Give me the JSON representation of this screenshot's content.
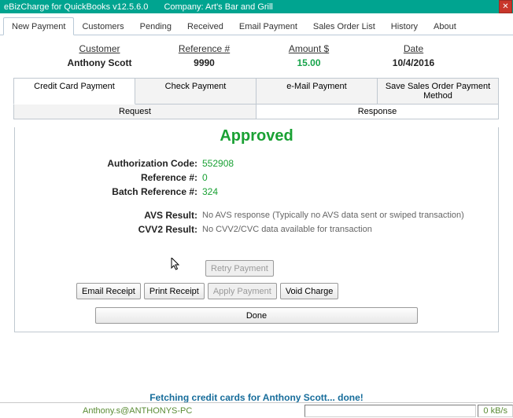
{
  "title_app": "eBizCharge for QuickBooks v12.5.6.0",
  "title_company": "Company: Art's Bar and Grill",
  "close_glyph": "✕",
  "tabs": [
    "New Payment",
    "Customers",
    "Pending",
    "Received",
    "Email Payment",
    "Sales Order List",
    "History",
    "About"
  ],
  "summary": {
    "h_customer": "Customer",
    "customer": "Anthony Scott",
    "h_ref": "Reference #",
    "ref": "9990",
    "h_amount": "Amount $",
    "amount": "15.00",
    "h_date": "Date",
    "date": "10/4/2016"
  },
  "pay_tabs": [
    "Credit Card Payment",
    "Check Payment",
    "e-Mail Payment",
    "Save Sales Order Payment Method"
  ],
  "rr_tabs": [
    "Request",
    "Response"
  ],
  "approved": "Approved",
  "kv": {
    "auth_k": "Authorization Code:",
    "auth_v": "552908",
    "ref_k": "Reference #:",
    "ref_v": "0",
    "batch_k": "Batch Reference #:",
    "batch_v": "324",
    "avs_k": "AVS Result:",
    "avs_v": "No AVS response (Typically no AVS data sent or swiped transaction)",
    "cvv_k": "CVV2 Result:",
    "cvv_v": "No CVV2/CVC data available for transaction"
  },
  "buttons": {
    "retry": "Retry Payment",
    "email": "Email Receipt",
    "print": "Print Receipt",
    "apply": "Apply Payment",
    "void": "Void Charge",
    "done": "Done"
  },
  "status_msg": "Fetching credit cards for Anthony Scott... done!",
  "status_user": "Anthony.s@ANTHONYS-PC",
  "status_rate": "0 kB/s"
}
